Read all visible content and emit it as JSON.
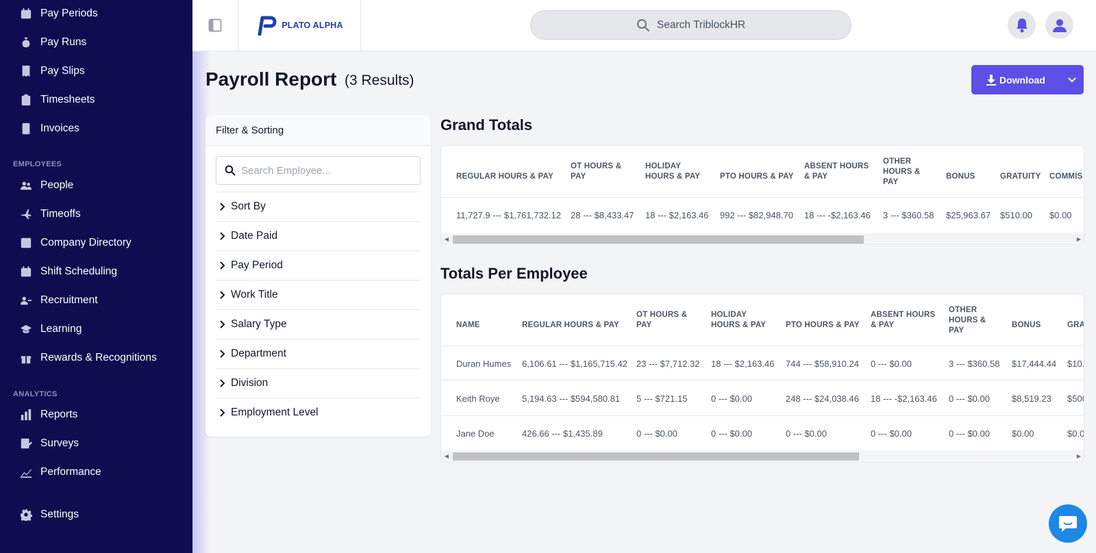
{
  "sidebar": {
    "items": [
      {
        "label": "Pay Periods",
        "icon": "calendar-icon"
      },
      {
        "label": "Pay Runs",
        "icon": "money-bag-icon"
      },
      {
        "label": "Pay Slips",
        "icon": "receipt-icon"
      },
      {
        "label": "Timesheets",
        "icon": "clipboard-icon"
      },
      {
        "label": "Invoices",
        "icon": "invoice-icon"
      }
    ],
    "employees_section": "EMPLOYEES",
    "employee_items": [
      {
        "label": "People",
        "icon": "users-icon"
      },
      {
        "label": "Timeoffs",
        "icon": "plane-icon"
      },
      {
        "label": "Company Directory",
        "icon": "directory-icon"
      },
      {
        "label": "Shift Scheduling",
        "icon": "calendar-icon"
      },
      {
        "label": "Recruitment",
        "icon": "recruit-icon"
      },
      {
        "label": "Learning",
        "icon": "graduation-cap-icon"
      },
      {
        "label": "Rewards & Recognitions",
        "icon": "gift-icon"
      }
    ],
    "analytics_section": "ANALYTICS",
    "analytics_items": [
      {
        "label": "Reports",
        "icon": "bar-chart-icon"
      },
      {
        "label": "Surveys",
        "icon": "survey-icon"
      },
      {
        "label": "Performance",
        "icon": "line-chart-icon"
      }
    ],
    "settings": {
      "label": "Settings",
      "icon": "gear-icon"
    }
  },
  "header": {
    "logo_text": "PLATO ALPHA",
    "search_placeholder": "Search TriblockHR"
  },
  "page": {
    "title": "Payroll Report",
    "results": "(3 Results)",
    "download_label": "Download"
  },
  "filter": {
    "heading": "Filter & Sorting",
    "search_placeholder": "Search Employee...",
    "items": [
      "Sort By",
      "Date Paid",
      "Pay Period",
      "Work Title",
      "Salary Type",
      "Department",
      "Division",
      "Employment Level"
    ]
  },
  "grand_totals": {
    "title": "Grand Totals",
    "headers": [
      "REGULAR HOURS & PAY",
      "OT HOURS & PAY",
      "HOLIDAY HOURS & PAY",
      "PTO HOURS & PAY",
      "ABSENT HOURS & PAY",
      "OTHER HOURS & PAY",
      "BONUS",
      "GRATUITY",
      "COMMIS"
    ],
    "values": [
      "11,727.9 --- $1,761,732.12",
      "28 --- $8,433.47",
      "18 --- $2,163.46",
      "992 --- $82,948.70",
      "18 --- -$2,163.46",
      "3 --- $360.58",
      "$25,963.67",
      "$510.00",
      "$0.00"
    ]
  },
  "per_employee": {
    "title": "Totals Per Employee",
    "headers": [
      "NAME",
      "REGULAR HOURS & PAY",
      "OT HOURS & PAY",
      "HOLIDAY HOURS & PAY",
      "PTO HOURS & PAY",
      "ABSENT HOURS & PAY",
      "OTHER HOURS & PAY",
      "BONUS",
      "GRA"
    ],
    "rows": [
      [
        "Duran Humes",
        "6,106.61 --- $1,165,715.42",
        "23 --- $7,712.32",
        "18 --- $2,163.46",
        "744 --- $58,910.24",
        "0 --- $0.00",
        "3 --- $360.58",
        "$17,444.44",
        "$10."
      ],
      [
        "Keith Roye",
        "5,194.63 --- $594,580.81",
        "5 --- $721.15",
        "0 --- $0.00",
        "248 --- $24,038.46",
        "18 --- -$2,163.46",
        "0 --- $0.00",
        "$8,519.23",
        "$500"
      ],
      [
        "Jane Doe",
        "426.66 --- $1,435.89",
        "0 --- $0.00",
        "0 --- $0.00",
        "0 --- $0.00",
        "0 --- $0.00",
        "0 --- $0.00",
        "$0.00",
        "$0.0"
      ]
    ]
  },
  "colors": {
    "sidebar_bg": "#0f0d4f",
    "accent": "#5b4fe6",
    "chat_button": "#1e88e5"
  }
}
